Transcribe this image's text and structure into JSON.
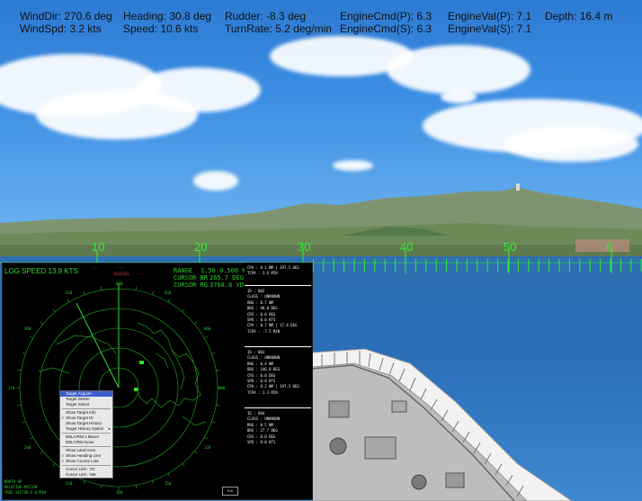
{
  "hud": {
    "row1": [
      "WindDir: 270.6 deg",
      "Heading: 30.8 deg",
      "Rudder: -8.3 deg",
      "EngineCmd(P): 6.3",
      "EngineVal(P): 7.1",
      "Depth: 16.4 m"
    ],
    "row2": [
      "WindSpd: 3.2 kts",
      "Speed: 10.6 kts",
      "TurnRate: 5.2 deg/min",
      "EngineCmd(S): 6.3",
      "EngineVal(S): 7.1"
    ]
  },
  "compass": {
    "labels": [
      "10",
      "20",
      "30",
      "40",
      "50",
      "6"
    ]
  },
  "radar": {
    "log_speed": "LOG SPEED 13.9 KTS",
    "header_values": [
      "---",
      "---"
    ],
    "header_labels": [
      "HEADING",
      "---"
    ],
    "range_label": "RANGE",
    "range_value": "1.50    0.500 NM",
    "cursor_br_label": "CURSOR BR",
    "cursor_br_value": "265.7 DEG",
    "cursor_rg_label": "CURSOR RG",
    "cursor_rg_value": "3768.6 YD",
    "bottom_left": [
      "NORTH UP",
      "RELATIVE MOTION",
      "TRUE VECTOR 6.0 MIN"
    ],
    "bottom_right_button": "Exit",
    "context_menu": [
      {
        "label": "Target Acquire",
        "checked": false,
        "highlighted": true
      },
      {
        "label": "Target Delete",
        "checked": false
      },
      {
        "label": "Target Select",
        "checked": false
      },
      {
        "sep": true
      },
      {
        "label": "Show Target Info",
        "checked": false
      },
      {
        "label": "Show Target ID",
        "checked": true
      },
      {
        "label": "Show Target History",
        "checked": false
      },
      {
        "label": "Target History Option",
        "checked": false,
        "submenu": true
      },
      {
        "sep": true
      },
      {
        "label": "EBL/VRM 1 Mover",
        "checked": false
      },
      {
        "label": "EBL/VRM None",
        "checked": false
      },
      {
        "sep": true
      },
      {
        "label": "Show Land Area",
        "checked": false
      },
      {
        "label": "Show Heading Line",
        "checked": true
      },
      {
        "label": "Show Course Line",
        "checked": true
      },
      {
        "sep": true
      },
      {
        "label": "Cursor Unit : YD",
        "checked": false
      },
      {
        "label": "Cursor Unit : NM",
        "checked": false
      }
    ]
  },
  "targets": [
    {
      "lines": [
        "CPA : 0.1 NM | 197.5 DEG",
        "TCPA : 3.6 MIN"
      ]
    },
    {
      "lines": [
        "ID : 002",
        "CLASS : UNKNOWN",
        "RNG : 0.7 NM",
        "BRG : 98.0 DEG",
        "CRS : 0.0 DEG",
        "SPD : 0.0 KTS",
        "CPA : 0.7 NM | 17.8 DEG",
        "TCPA : -7.5 MIN"
      ]
    },
    {
      "lines": [
        "ID : 003",
        "CLASS : UNKNOWN",
        "RNG : 0.4 NM",
        "BRG : 146.0 DEG",
        "CRS : 0.0 DEG",
        "SPD : 0.0 KTS",
        "CPA : 0.2 NM | 197.5 DEG",
        "TCPA : 1.3 MIN"
      ]
    },
    {
      "lines": [
        "ID : 004",
        "CLASS : UNKNOWN",
        "RNG : 0.5 NM",
        "BRG : 27.7 DEG",
        "CRS : 0.0 DEG",
        "SPD : 0.0 KTS"
      ]
    }
  ]
}
